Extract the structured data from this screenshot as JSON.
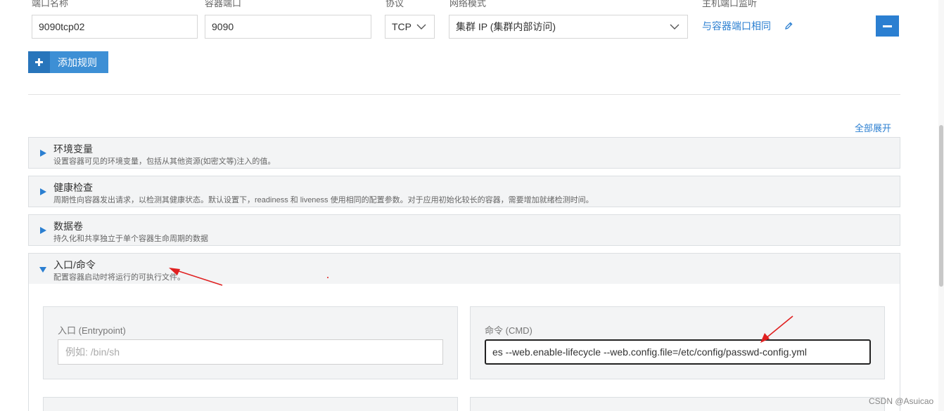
{
  "port_rule": {
    "headers": {
      "port_name": "端口名称",
      "container_port": "容器端口",
      "protocol": "协议",
      "network_mode": "网络模式",
      "host_port_listen": "主机端口监听"
    },
    "port_name_value": "9090tcp02",
    "container_port_value": "9090",
    "protocol_value": "TCP",
    "network_mode_value": "集群 IP (集群内部访问)",
    "host_port_link": "与容器端口相同"
  },
  "add_rule_label": "添加规则",
  "expand_all_label": "全部展开",
  "sections": [
    {
      "title": "环境变量",
      "desc": "设置容器可见的环境变量，包括从其他资源(如密文等)注入的值。"
    },
    {
      "title": "健康检查",
      "desc": "周期性向容器发出请求，以检测其健康状态。默认设置下，readiness 和 liveness 使用相同的配置参数。对于应用初始化较长的容器，需要增加就绪检测时间。"
    },
    {
      "title": "数据卷",
      "desc": "持久化和共享独立于单个容器生命周期的数据"
    },
    {
      "title": "入口/命令",
      "desc": "配置容器启动时将运行的可执行文件。"
    }
  ],
  "entrypoint": {
    "label": "入口 (Entrypoint)",
    "placeholder": "例如: /bin/sh"
  },
  "command": {
    "label": "命令 (CMD)",
    "value": "es --web.enable-lifecycle --web.config.file=/etc/config/passwd-config.yml"
  },
  "watermark": "CSDN @Asuicao",
  "colors": {
    "accent": "#2b7fd1",
    "annotation_arrow": "#e02020"
  }
}
